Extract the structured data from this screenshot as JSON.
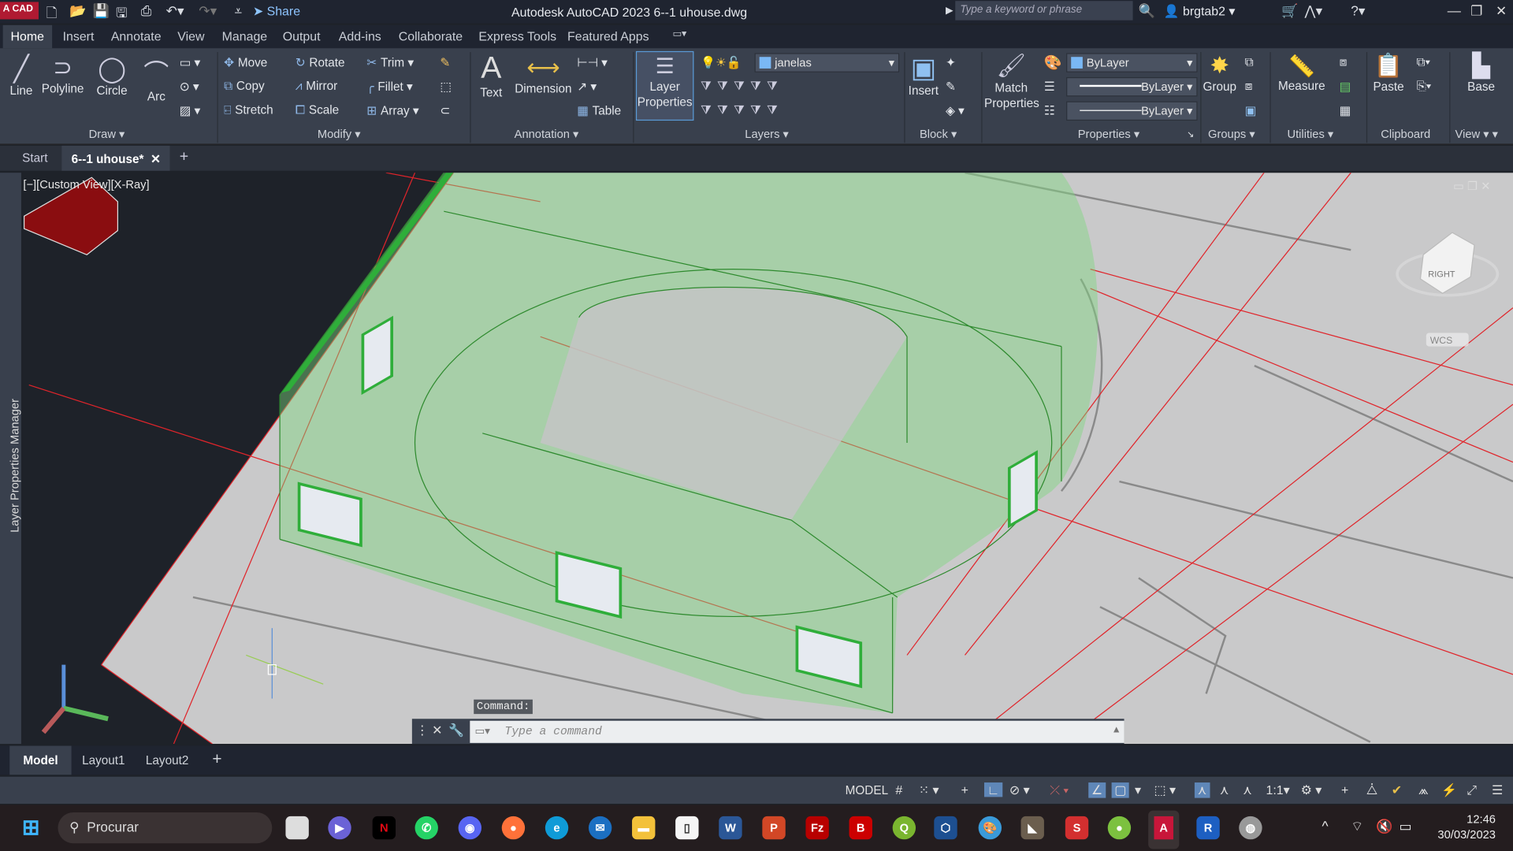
{
  "titlebar": {
    "logo": "A CAD",
    "share": "Share",
    "title": "Autodesk AutoCAD 2023    6--1 uhouse.dwg",
    "search_placeholder": "Type a keyword or phrase",
    "user": "brgtab2"
  },
  "ribbon_tabs": [
    "Home",
    "Insert",
    "Annotate",
    "View",
    "Manage",
    "Output",
    "Add-ins",
    "Collaborate",
    "Express Tools",
    "Featured Apps"
  ],
  "draw": {
    "label": "Draw",
    "line": "Line",
    "polyline": "Polyline",
    "circle": "Circle",
    "arc": "Arc"
  },
  "modify": {
    "label": "Modify",
    "move": "Move",
    "rotate": "Rotate",
    "trim": "Trim",
    "copy": "Copy",
    "mirror": "Mirror",
    "fillet": "Fillet",
    "stretch": "Stretch",
    "scale": "Scale",
    "array": "Array"
  },
  "annotation": {
    "label": "Annotation",
    "text": "Text",
    "dimension": "Dimension",
    "table": "Table"
  },
  "layers": {
    "label": "Layers",
    "layer_properties": "Layer Properties",
    "current_layer": "janelas"
  },
  "block": {
    "label": "Block",
    "insert": "Insert"
  },
  "properties": {
    "label": "Properties",
    "match": "Match Properties",
    "color": "ByLayer",
    "linetype": "ByLayer",
    "lineweight": "ByLayer"
  },
  "groups": {
    "label": "Groups",
    "group": "Group"
  },
  "utilities": {
    "label": "Utilities",
    "measure": "Measure"
  },
  "clipboard": {
    "label": "Clipboard",
    "paste": "Paste"
  },
  "view": {
    "label": "View",
    "base": "Base"
  },
  "doc_tabs": {
    "start": "Start",
    "current": "6--1 uhouse*"
  },
  "viewport": {
    "label": "[−][Custom View][X-Ray]",
    "side_panel": "Layer Properties Manager",
    "viewcube": "RIGHT",
    "wcs": "WCS",
    "accent_green": "#2fae3a",
    "red_lines": "#e0242a"
  },
  "command": {
    "label": "Command:",
    "placeholder": "Type a command"
  },
  "layout_tabs": [
    "Model",
    "Layout1",
    "Layout2"
  ],
  "status": {
    "model": "MODEL",
    "scale": "1:1"
  },
  "taskbar": {
    "search": "Procurar",
    "time": "12:46",
    "date": "30/03/2023"
  }
}
